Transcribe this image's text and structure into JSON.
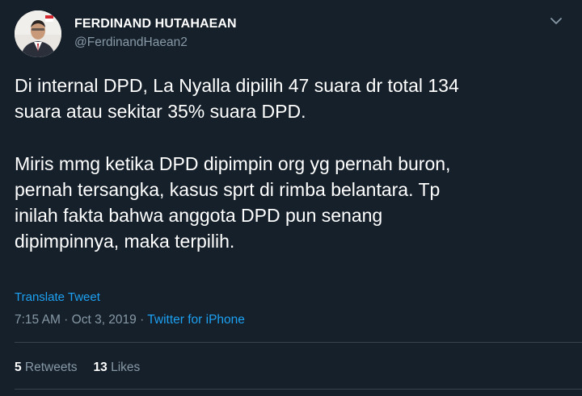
{
  "author": {
    "display_name": "FERDINAND HUTAHAEAN",
    "handle": "@FerdinandHaean2"
  },
  "tweet": {
    "lines_p1": [
      "Di internal DPD, La Nyalla dipilih 47 suara dr total 134",
      "suara atau sekitar 35% suara DPD."
    ],
    "lines_p2": [
      "Miris mmg ketika DPD dipimpin org yg pernah buron,",
      "pernah tersangka, kasus sprt di rimba belantara. Tp",
      "inilah fakta bahwa anggota DPD pun senang",
      "dipimpinnya, maka terpilih."
    ],
    "translate_label": "Translate Tweet",
    "time": "7:15 AM",
    "date": "Oct 3, 2019",
    "separator": " · ",
    "source": "Twitter for iPhone"
  },
  "stats": {
    "retweets_count": "5",
    "retweets_label": " Retweets",
    "likes_count": "13",
    "likes_label": " Likes"
  },
  "colors": {
    "background": "#15202b",
    "text": "#ffffff",
    "muted": "#8899a6",
    "accent": "#1da1f2",
    "divider": "#38444d"
  },
  "icons": {
    "menu": "chevron-down-icon"
  }
}
